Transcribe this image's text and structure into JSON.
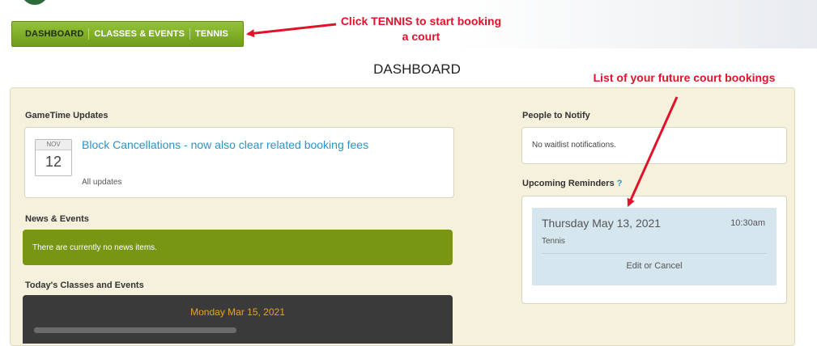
{
  "nav": {
    "items": [
      "DASHBOARD",
      "CLASSES & EVENTS",
      "TENNIS"
    ]
  },
  "page_title": "DASHBOARD",
  "annotations": {
    "tennis_note": "Click TENNIS to start booking a court",
    "bookings_note": "List of your future court bookings",
    "color": "#e0132b"
  },
  "gametime": {
    "title": "GameTime Updates",
    "month": "NOV",
    "day": "12",
    "headline": "Block Cancellations - now also clear related booking fees",
    "all_updates": "All updates"
  },
  "news": {
    "title": "News & Events",
    "message": "There are currently no news items."
  },
  "classes": {
    "title": "Today's Classes and Events",
    "date": "Monday Mar 15, 2021"
  },
  "notify": {
    "title": "People to Notify",
    "message": "No waitlist notifications."
  },
  "reminders": {
    "title": "Upcoming Reminders",
    "help": "?",
    "booking": {
      "date": "Thursday May 13, 2021",
      "time": "10:30am",
      "sport": "Tennis",
      "action": "Edit or Cancel"
    }
  },
  "colors": {
    "nav_green": "#7fae28",
    "panel_bg": "#f5f1dc",
    "news_green": "#789514",
    "link_blue": "#2a93c9",
    "reminder_bg": "#d6e6ee",
    "classes_dark": "#3a3a3a",
    "classes_date": "#e3a623"
  }
}
